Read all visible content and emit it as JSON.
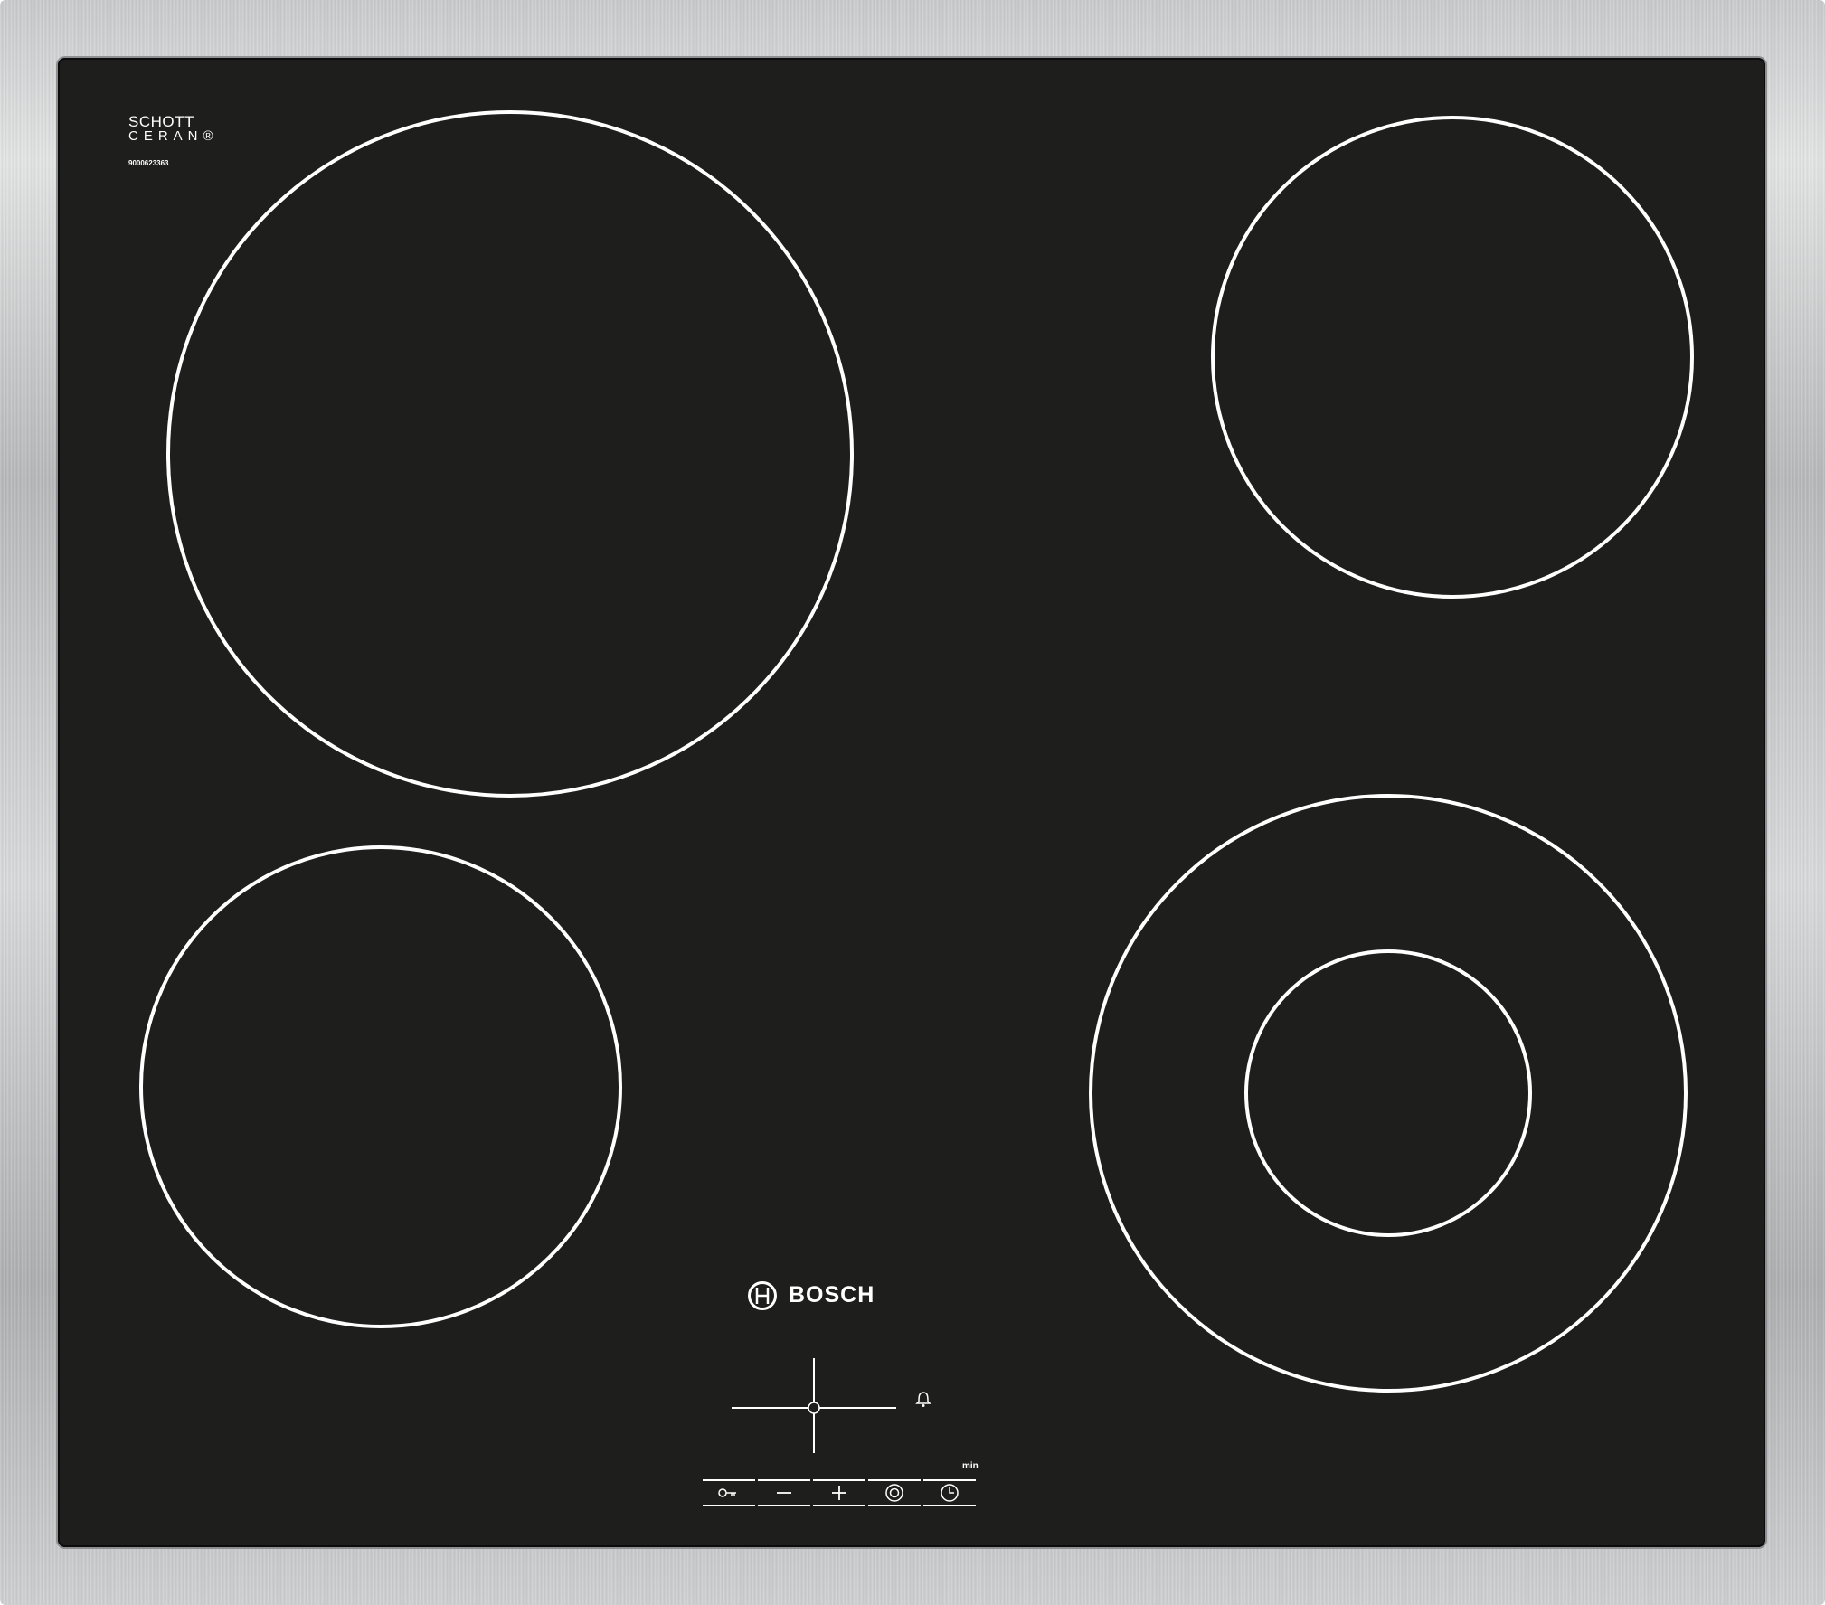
{
  "product": {
    "glass_brand_line1": "SCHOTT",
    "glass_brand_line2": "CERAN",
    "registered_mark": "®",
    "model_number": "9000623363",
    "manufacturer": "BOSCH"
  },
  "cooking_zones": [
    {
      "name": "front-left",
      "type": "single"
    },
    {
      "name": "rear-right",
      "type": "single"
    },
    {
      "name": "rear-left",
      "type": "single"
    },
    {
      "name": "front-right",
      "type": "dual"
    }
  ],
  "control_panel": {
    "timer_unit_label": "min",
    "zone_selector_icon": "zone-selector-cross-icon",
    "timer_alarm_icon": "bell-icon",
    "sensors": [
      {
        "id": "child-lock",
        "icon": "key-icon"
      },
      {
        "id": "minus",
        "icon": "minus-icon"
      },
      {
        "id": "plus",
        "icon": "plus-icon"
      },
      {
        "id": "dual-zone",
        "icon": "dual-ring-icon"
      },
      {
        "id": "timer",
        "icon": "clock-icon"
      }
    ]
  },
  "colors": {
    "glass": "#1e1e1d",
    "markings": "#ffffff",
    "frame": "#c9cbcc"
  }
}
